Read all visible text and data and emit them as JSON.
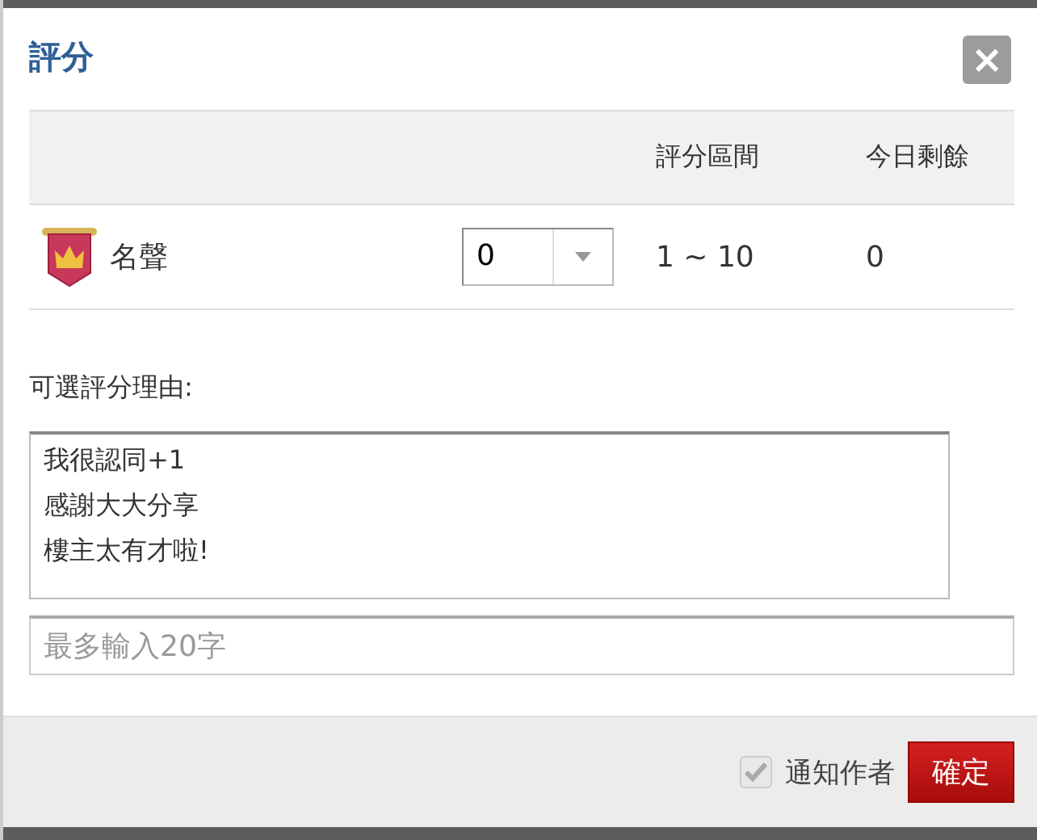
{
  "dialog": {
    "title": "評分",
    "close": "×"
  },
  "table": {
    "columns": [
      "評分區間",
      "今日剩餘"
    ],
    "rows": [
      {
        "name": "名聲",
        "score": "0",
        "range": "1 ~ 10",
        "remaining": "0"
      }
    ]
  },
  "reasons": {
    "label": "可選評分理由:",
    "options": [
      {
        "text": "我很認同+1",
        "selected": false
      },
      {
        "text": "感謝大大分享",
        "selected": false
      },
      {
        "text": "樓主太有才啦!",
        "selected": false
      }
    ]
  },
  "comment": {
    "placeholder": "最多輸入20字"
  },
  "footer": {
    "notify": {
      "label": "通知作者",
      "checked": true,
      "disabled": true
    },
    "confirm": "確定"
  }
}
